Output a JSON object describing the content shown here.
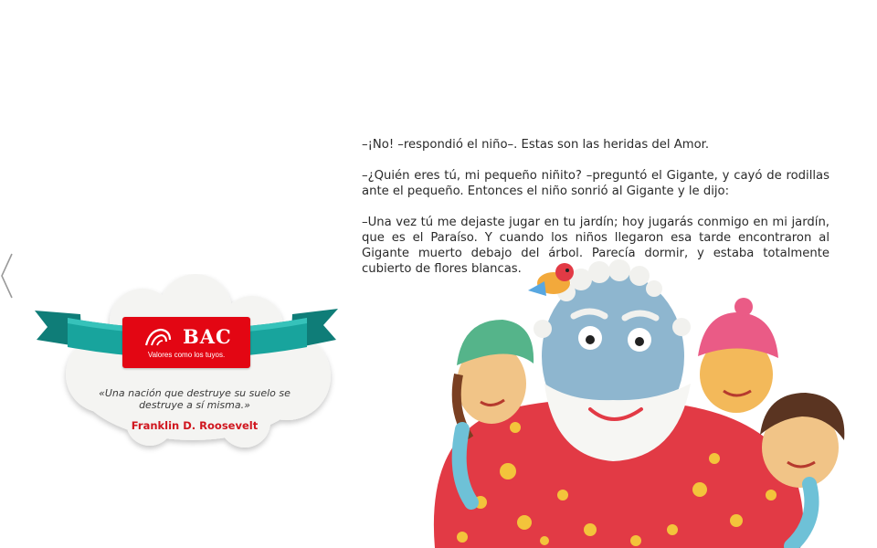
{
  "navigation": {
    "prev_icon": "chevron-left-icon"
  },
  "story": {
    "paragraphs": [
      "–¡No! –respondió el niño–. Estas son las heridas del Amor.",
      "–¿Quién eres tú, mi pequeño niñito? –preguntó el Gigante, y cayó de rodillas ante el pequeño. Entonces el niño sonrió al Gigante y le dijo:",
      "–Una vez  tú me  dejaste jugar en tu jardín; hoy jugarás conmigo en mi jardín, que es el Paraíso. Y cuando los niños llegaron esa tarde encontraron al Gigante muerto debajo del árbol. Parecía dormir, y estaba totalmente cubierto de flores blancas."
    ]
  },
  "sponsor": {
    "brand": "BAC",
    "tagline": "Valores como los tuyos.",
    "quote": "«Una nación que destruye su suelo se destruye a sí misma.»",
    "author": "Franklin D. Roosevelt"
  },
  "colors": {
    "brand_red": "#e30613",
    "ribbon_teal": "#169b95",
    "author_red": "#d0161f"
  }
}
